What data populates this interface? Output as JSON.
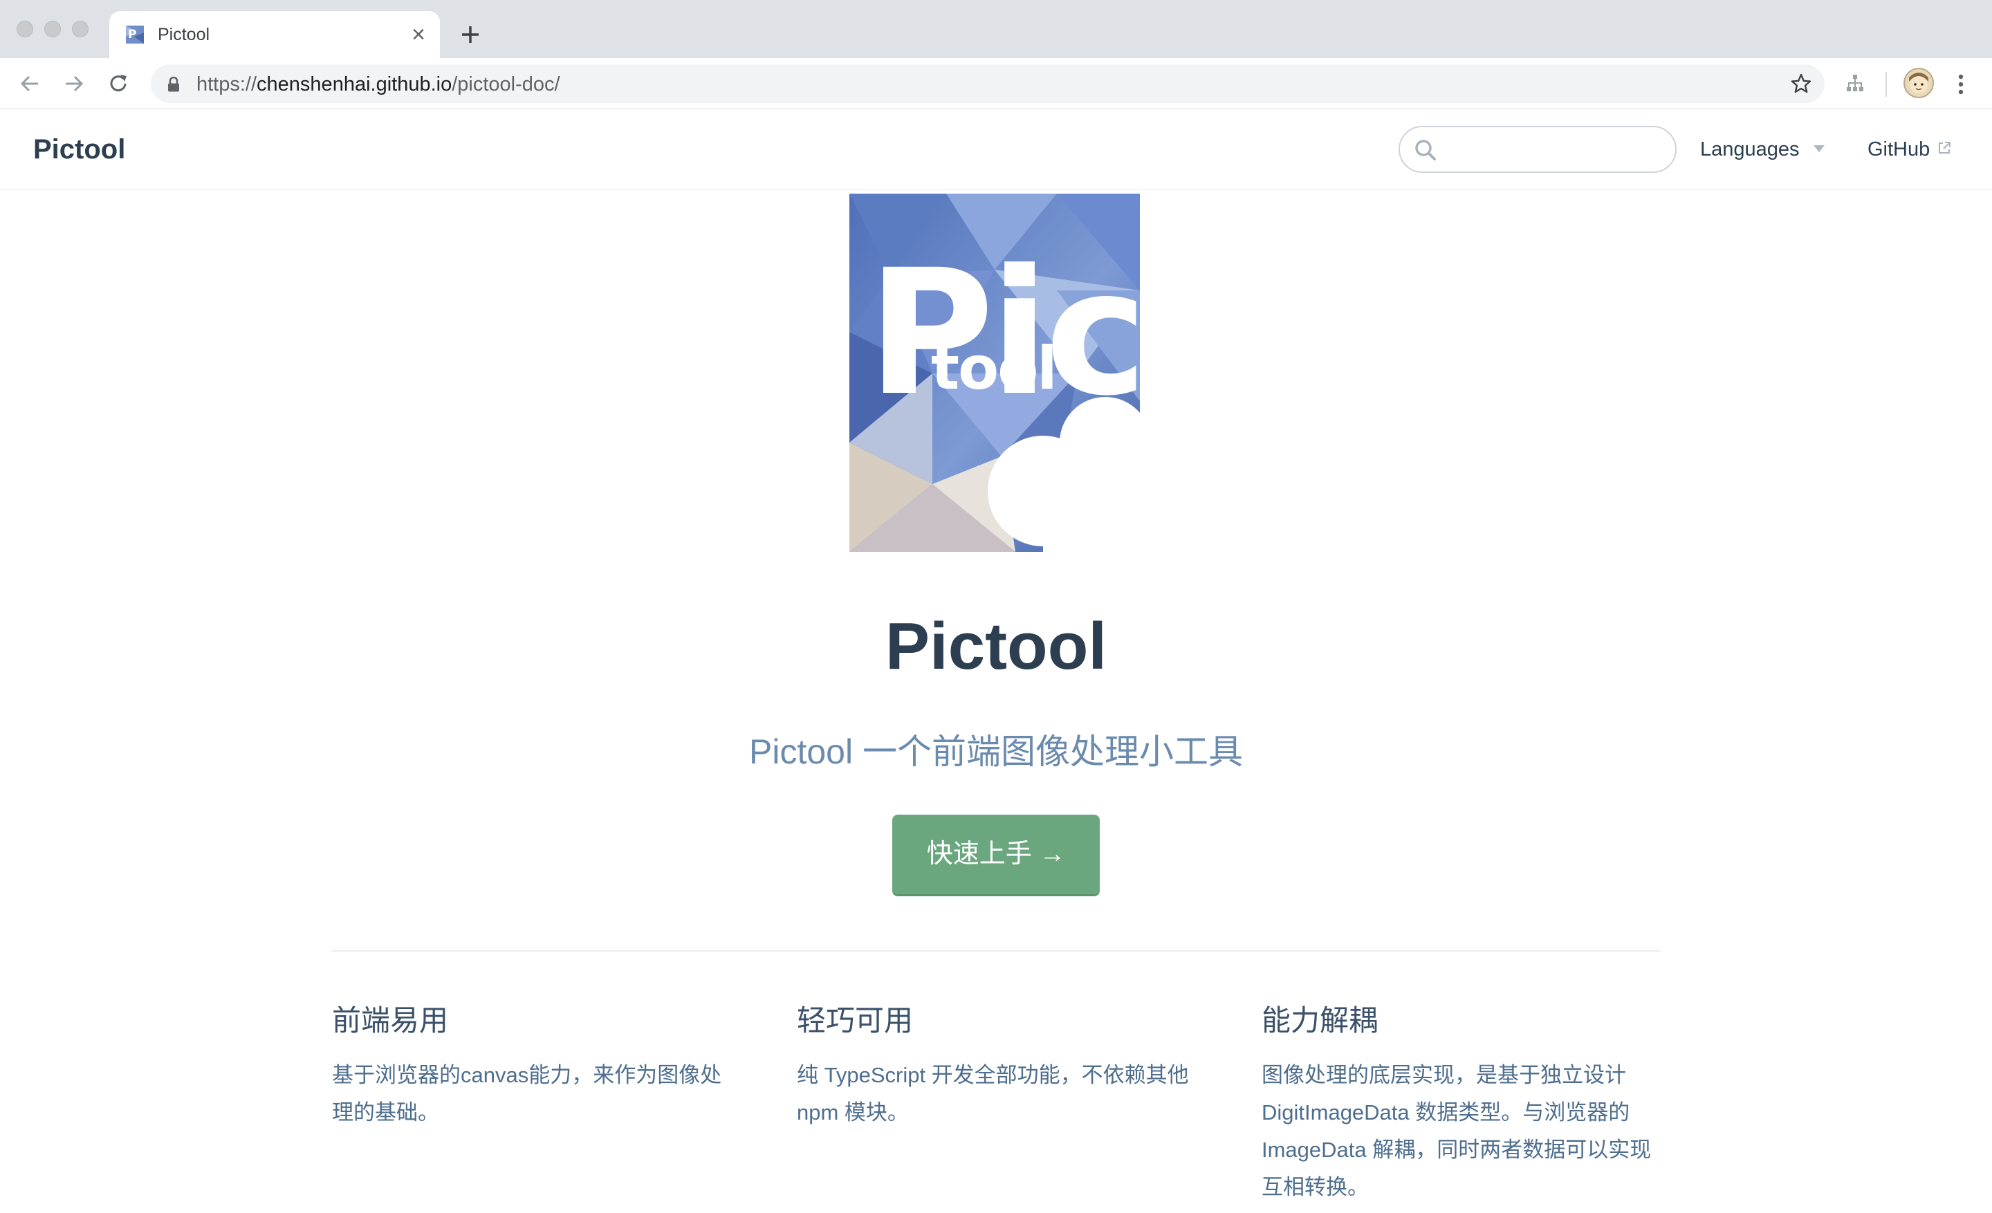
{
  "browser": {
    "tab_title": "Pictool",
    "url_protocol": "https://",
    "url_host": "chenshenhai.github.io",
    "url_path": "/pictool-doc/"
  },
  "navbar": {
    "site_name": "Pictool",
    "search_placeholder": "",
    "languages_label": "Languages",
    "github_label": "GitHub"
  },
  "hero": {
    "logo_text_top": "Pic",
    "logo_text_bottom": "tool",
    "title": "Pictool",
    "description": "Pictool 一个前端图像处理小工具",
    "action_label": "快速上手 →"
  },
  "features": [
    {
      "title": "前端易用",
      "details": "基于浏览器的canvas能力，来作为图像处理的基础。"
    },
    {
      "title": "轻巧可用",
      "details": "纯 TypeScript 开发全部功能，不依赖其他 npm 模块。"
    },
    {
      "title": "能力解耦",
      "details": "图像处理的底层实现，是基于独立设计DigitImageData 数据类型。与浏览器的 ImageData 解耦，同时两者数据可以实现互相转换。"
    }
  ],
  "colors": {
    "accent": "#6aa77f",
    "text": "#2c3e50",
    "description": "#6a8bad"
  }
}
